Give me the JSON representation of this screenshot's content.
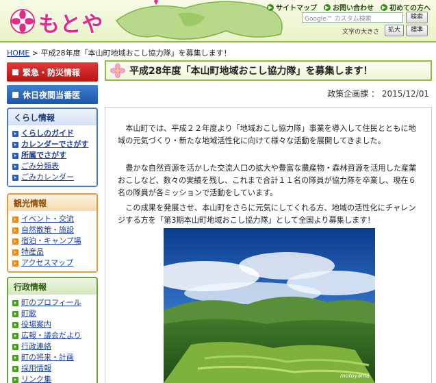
{
  "header": {
    "logo_text": "もとやま",
    "nav": [
      {
        "label": "サイトマップ"
      },
      {
        "label": "お問い合わせ"
      },
      {
        "label": "初めての方へ"
      }
    ],
    "search_placeholder": "Google™ カスタム検索",
    "search_button": "検索",
    "fontsize_label": "文字の大きさ",
    "fontsize_large": "拡大",
    "fontsize_standard": "標準",
    "brand_color": "#e02c86"
  },
  "breadcrumb": {
    "home": "HOME",
    "separator": ">",
    "current": "平成28年度「本山町地域おこし協力隊」を募集します！"
  },
  "sidebar": {
    "emergency": "緊急・防災情報",
    "holiday": "休日夜間当番医",
    "kurashi": {
      "title": "くらし情報",
      "items": [
        "くらしのガイド",
        "カレンダーでさがす",
        "所属でさがす",
        "ごみ分類表",
        "ごみカレンダー"
      ]
    },
    "kanko": {
      "title": "観光情報",
      "items": [
        "イベント・交流",
        "自然散策・施設",
        "宿泊・キャンプ場",
        "特産品",
        "アクセスマップ"
      ]
    },
    "gyosei": {
      "title": "行政情報",
      "items": [
        "町のプロフィール",
        "町歌",
        "役場案内",
        "広報・議会だより",
        "行政連絡",
        "町の将来・計画",
        "採用情報",
        "リンク集"
      ]
    }
  },
  "main": {
    "title": "平成28年度「本山町地域おこし協力隊」を募集します！",
    "department": "政策企画課 ： 2015/12/01",
    "paragraphs": [
      "本山町では、平成２２年度より「地域おこし協力隊」事業を導入して住民とともに地域の元気づくり・新たな地域活性化に向けて様々な活動を展開してきました。",
      "豊かな自然資源を活かした交流人口の拡大や豊富な農産物・森林資源を活用した産業おこしなど、数々の実績を残し、これまで合計１１名の隊員が協力隊を卒業し、現在６名の隊員が各ミッションで活動をしています。",
      "この成果を発展させ、本山町をさらに元気にしてくれる方、地域の活性化にチャレンジする方を「第3期本山町地域おこし協力隊」として全国より募集します！"
    ],
    "photo_credit": "motoyama"
  }
}
